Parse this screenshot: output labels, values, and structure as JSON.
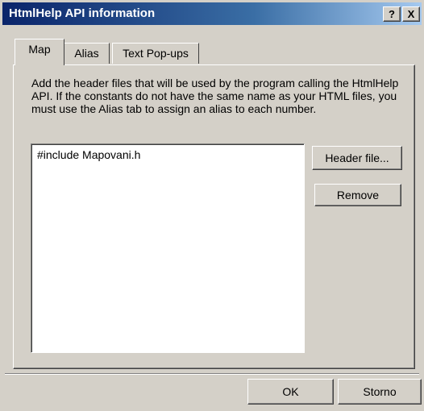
{
  "window": {
    "title": "HtmlHelp API information",
    "help_button": "?",
    "close_button": "X"
  },
  "tabs": [
    {
      "label": "Map",
      "active": true
    },
    {
      "label": "Alias",
      "active": false
    },
    {
      "label": "Text Pop-ups",
      "active": false
    }
  ],
  "map_tab": {
    "description": "Add the header files that will be used by the program calling the HtmlHelp API. If the constants do not have the same name as your HTML files, you must use the Alias tab to assign an alias to each number.",
    "header_files": [
      "#include Mapovani.h"
    ],
    "header_file_button": "Header file...",
    "remove_button": "Remove"
  },
  "footer": {
    "ok_button": "OK",
    "cancel_button": "Storno"
  }
}
